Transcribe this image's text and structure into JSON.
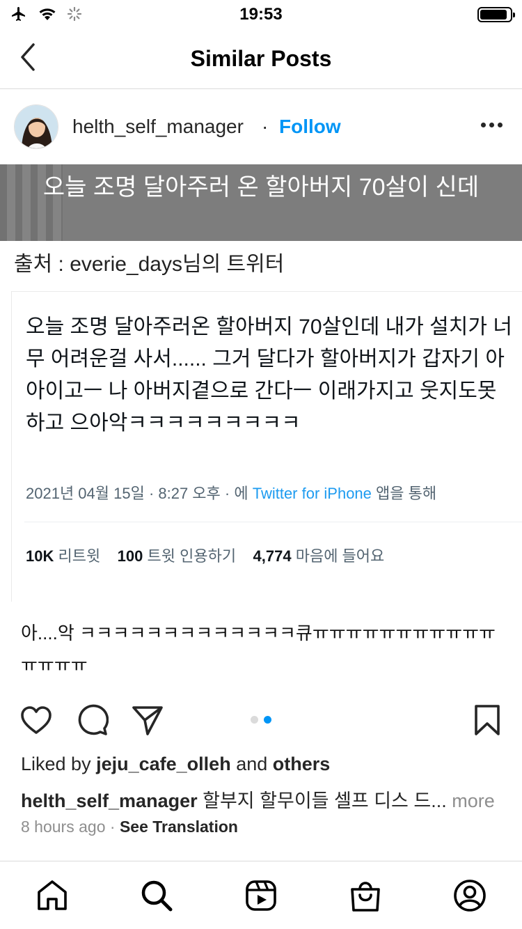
{
  "status_bar": {
    "time": "19:53",
    "battery_level": 0.9
  },
  "header": {
    "title": "Similar Posts"
  },
  "post": {
    "username": "helth_self_manager",
    "separator": "·",
    "follow_label": "Follow",
    "image": {
      "title": "오늘 조명 달아주러 온 할아버지 70살이 신데",
      "source": "출처 : everie_days님의 트위터",
      "tweet_text": "오늘 조명 달아주러온 할아버지 70살인데 내가 설치가 너무 어려운걸 사서...... 그거 달다가 할아버지가 갑자기 아 아이고ㅡ 나 아버지곁으로 간다ㅡ 이래가지고 웃지도못하고 으아악ㅋㅋㅋㅋㅋㅋㅋㅋㅋ",
      "tweet_date": "2021년 04월 15일 · 8:27 오후 · 에",
      "tweet_client": "Twitter for iPhone",
      "tweet_client_suffix": "앱을 통해",
      "retweets_count": "10K",
      "retweets_label": "리트윗",
      "quotes_count": "100",
      "quotes_label": "트윗 인용하기",
      "likes_count": "4,774",
      "likes_label": "마음에 들어요",
      "caption": "아....악 ㅋㅋㅋㅋㅋㅋㅋㅋㅋㅋㅋㅋㅋ큐ㅠㅠㅠㅠㅠㅠㅠㅠㅠㅠㅠㅠㅠㅠㅠ"
    },
    "carousel": {
      "count": 2,
      "active": 1,
      "active_color": "#0095f6",
      "inactive_color": "#dbdbdb"
    },
    "liked_by_prefix": "Liked by",
    "liked_by_user": "jeju_cafe_olleh",
    "liked_by_and": "and",
    "liked_by_others": "others",
    "caption_user": "helth_self_manager",
    "caption_text": "할부지 할무이들 셀프 디스 드...",
    "caption_more": "more",
    "time_ago": "8 hours ago",
    "time_sep": "·",
    "see_translation": "See Translation"
  },
  "icons": {
    "status": [
      "airplane-icon",
      "wifi-icon",
      "activity-spinner-icon",
      "battery-icon"
    ],
    "actions": [
      "heart-icon",
      "comment-icon",
      "share-icon",
      "bookmark-icon"
    ],
    "nav": [
      "home-icon",
      "search-icon",
      "reels-icon",
      "shop-icon",
      "profile-icon"
    ]
  }
}
